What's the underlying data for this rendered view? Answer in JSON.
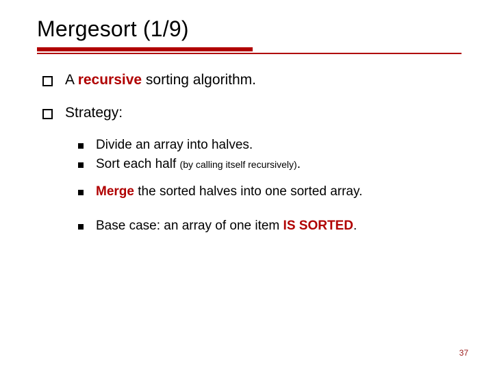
{
  "title": "Mergesort (1/9)",
  "bullets": {
    "p1_pre": "A ",
    "p1_bold": "recursive",
    "p1_post": " sorting algorithm.",
    "p2": "Strategy:",
    "s1": "Divide an array into halves.",
    "s2_pre": "Sort each half ",
    "s2_small": "(by calling itself recursively)",
    "s2_post": ".",
    "s3_bold": "Merge",
    "s3_post": " the sorted halves into one sorted array.",
    "s4_pre": "Base case: an array of one item ",
    "s4_bold": "IS SORTED",
    "s4_post": "."
  },
  "page_number": "37"
}
